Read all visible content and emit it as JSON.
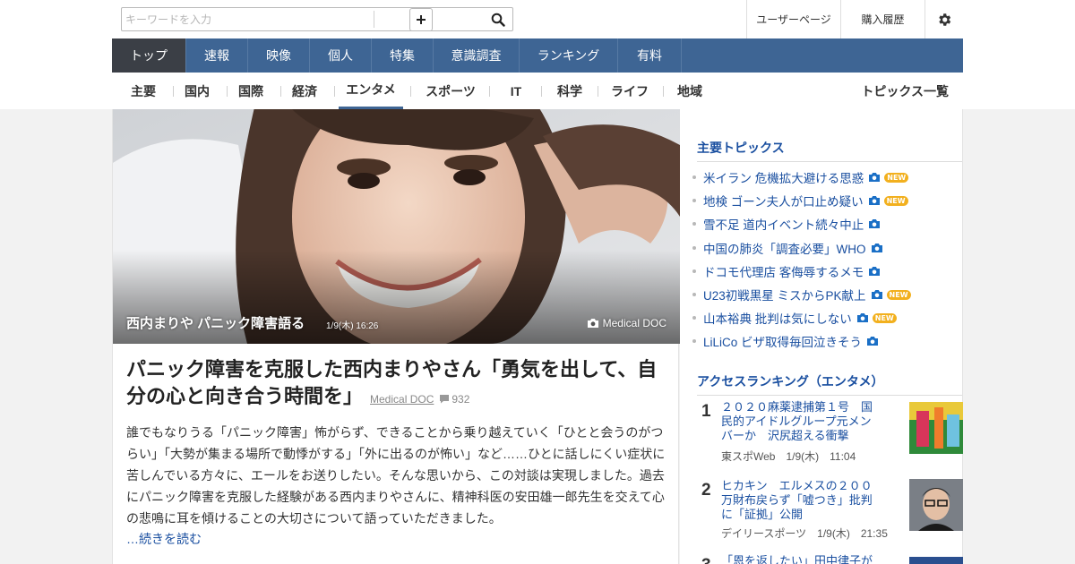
{
  "search": {
    "placeholder": "キーワードを入力"
  },
  "header_links": {
    "user_page": "ユーザーページ",
    "purchase_history": "購入履歴"
  },
  "main_nav": [
    {
      "label": "トップ"
    },
    {
      "label": "速報"
    },
    {
      "label": "映像"
    },
    {
      "label": "個人"
    },
    {
      "label": "特集"
    },
    {
      "label": "意識調査"
    },
    {
      "label": "ランキング"
    },
    {
      "label": "有料"
    }
  ],
  "sub_nav": [
    {
      "label": "主要"
    },
    {
      "label": "国内"
    },
    {
      "label": "国際"
    },
    {
      "label": "経済"
    },
    {
      "label": "エンタメ"
    },
    {
      "label": "スポーツ"
    },
    {
      "label": "IT"
    },
    {
      "label": "科学"
    },
    {
      "label": "ライフ"
    },
    {
      "label": "地域"
    }
  ],
  "topics_all": "トピックス一覧",
  "hero": {
    "caption": "西内まりや パニック障害語る",
    "time": "1/9(木) 16:26",
    "source": "Medical DOC"
  },
  "article": {
    "title": "パニック障害を克服した西内まりやさん「勇気を出して、自分の心と向き合う時間を」",
    "source": "Medical DOC",
    "comments": "932",
    "body": "誰でもなりうる「パニック障害」怖がらず、できることから乗り越えていく「ひとと会うのがつらい」「大勢が集まる場所で動悸がする」「外に出るのが怖い」など……ひとに話しにくい症状に苦しんでいる方々に、エールをお送りしたい。そんな思いから、この対談は実現しました。過去にパニック障害を克服した経験がある西内まりやさんに、精神科医の安田雄一郎先生を交えて心の悲鳴に耳を傾けることの大切さについて語っていただきました。",
    "read_more": "…続きを読む"
  },
  "sidebar": {
    "topics_heading": "主要トピックス",
    "topics": [
      {
        "label": "米イラン 危機拡大避ける思惑",
        "camera": true,
        "new": true
      },
      {
        "label": "地検 ゴーン夫人が口止め疑い",
        "camera": true,
        "new": true
      },
      {
        "label": "雪不足 道内イベント続々中止",
        "camera": true,
        "new": false
      },
      {
        "label": "中国の肺炎「調査必要」WHO",
        "camera": true,
        "new": false
      },
      {
        "label": "ドコモ代理店 客侮辱するメモ",
        "camera": true,
        "new": false
      },
      {
        "label": "U23初戦黒星 ミスからPK献上",
        "camera": true,
        "new": true
      },
      {
        "label": "山本裕典 批判は気にしない",
        "camera": true,
        "new": true
      },
      {
        "label": "LiLiCo ビザ取得毎回泣きそう",
        "camera": true,
        "new": false
      }
    ],
    "new_label": "NEW",
    "ranking_heading": "アクセスランキング（エンタメ）",
    "ranking": [
      {
        "rank": "1",
        "title": "２０２０麻薬逮捕第１号　国民的アイドルグループ元メンバーか　沢尻超える衝撃",
        "meta": "東スポWeb　1/9(木)　11:04"
      },
      {
        "rank": "2",
        "title": "ヒカキン　エルメスの２００万財布戻らず「嘘つき」批判に「証拠」公開",
        "meta": "デイリースポーツ　1/9(木)　21:35"
      },
      {
        "rank": "3",
        "title": "「恩を返したい」田中律子が難婚",
        "meta": ""
      }
    ]
  },
  "colors": {
    "nav_bg": "#3e6594",
    "nav_active": "#3b3f46",
    "link": "#1a4fa0",
    "badge_new": "#f2b01e"
  }
}
